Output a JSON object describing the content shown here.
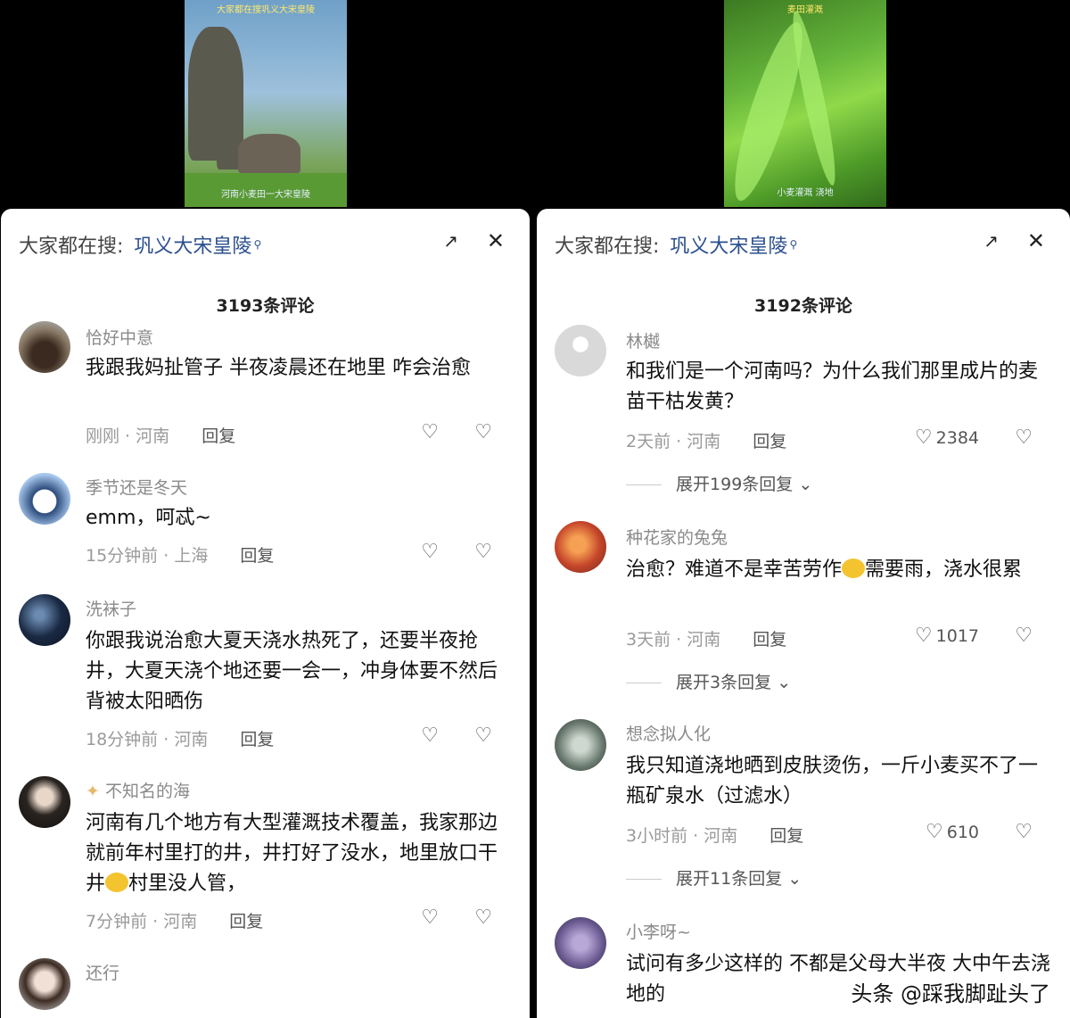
{
  "videos": {
    "left": {
      "caption_top": "大家都在搜巩义大宋皇陵",
      "caption_bottom": "河南小麦田一大宋皇陵"
    },
    "right": {
      "caption_top": "麦田灌溉",
      "caption_bottom": "小麦灌溉 浇地"
    }
  },
  "panels": [
    {
      "search_label": "大家都在搜:",
      "search_term": "巩义大宋皇陵",
      "comment_count": "3193条评论",
      "comments": [
        {
          "name": "恰好中意",
          "text": "我跟我妈扯管子 半夜凌晨还在地里 咋会治愈",
          "time": "刚刚",
          "location": "河南",
          "reply": "回复",
          "likes": ""
        },
        {
          "name": "季节还是冬天",
          "text": "emm，呵忒~",
          "time": "15分钟前",
          "location": "上海",
          "reply": "回复",
          "likes": ""
        },
        {
          "name": "洗袜子",
          "text": "你跟我说治愈大夏天浇水热死了，还要半夜抢井，大夏天浇个地还要一会一，冲身体要不然后背被太阳晒伤",
          "time": "18分钟前",
          "location": "河南",
          "reply": "回复",
          "likes": ""
        },
        {
          "name": "不知名的海",
          "text_a": "河南有几个地方有大型灌溉技术覆盖，我家那边就前年村里打的井，井打好了没水，地里放口干井",
          "text_b": "村里没人管，",
          "time": "7分钟前",
          "location": "河南",
          "reply": "回复",
          "likes": ""
        },
        {
          "name": "还行",
          "text": "",
          "time": "",
          "location": "",
          "reply": "",
          "likes": ""
        }
      ]
    },
    {
      "search_label": "大家都在搜:",
      "search_term": "巩义大宋皇陵",
      "comment_count": "3192条评论",
      "comments": [
        {
          "name": "林樾",
          "text": "和我们是一个河南吗？为什么我们那里成片的麦苗干枯发黄？",
          "time": "2天前",
          "location": "河南",
          "reply": "回复",
          "likes": "2384",
          "expand": "展开199条回复"
        },
        {
          "name": "种花家的兔兔",
          "text_a": "治愈？难道不是幸苦劳作",
          "text_b": "需要雨，浇水很累",
          "time": "3天前",
          "location": "河南",
          "reply": "回复",
          "likes": "1017",
          "expand": "展开3条回复"
        },
        {
          "name": "想念拟人化",
          "text": "我只知道浇地晒到皮肤烫伤，一斤小麦买不了一瓶矿泉水（过滤水）",
          "time": "3小时前",
          "location": "河南",
          "reply": "回复",
          "likes": "610",
          "expand": "展开11条回复"
        },
        {
          "name": "小李呀~",
          "text": "试问有多少这样的 不都是父母大半夜 大中午去浇地的",
          "time": "",
          "location": "",
          "reply": "",
          "likes": ""
        }
      ]
    }
  ],
  "watermark": "头条 @踩我脚趾头了",
  "colors": {
    "link": "#2b4f8f",
    "meta": "#9a9a9a",
    "background": "#000000"
  }
}
